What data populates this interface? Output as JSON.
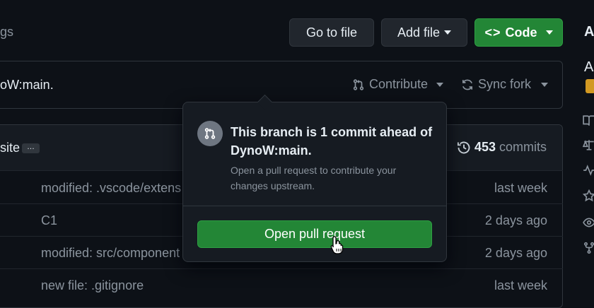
{
  "header": {
    "left_partial": "gs",
    "go_to_file": "Go to file",
    "add_file": "Add file",
    "code": "Code",
    "sidebar_title": "A"
  },
  "fork_bar": {
    "status_partial": "oW:main.",
    "contribute": "Contribute",
    "sync_fork": "Sync fork",
    "sidebar_letter": "A"
  },
  "commit_header": {
    "partial": "site",
    "ellipsis": "…",
    "commit_count": "453",
    "commits_label": "commits"
  },
  "files": [
    {
      "message": "modified: .vscode/extens",
      "time": "last week"
    },
    {
      "message": "C1",
      "time": "2 days ago"
    },
    {
      "message": "modified: src/component",
      "time": "2 days ago"
    },
    {
      "message": "new file: .gitignore",
      "time": "last week"
    }
  ],
  "popover": {
    "title_line1": "This branch is 1 commit ahead of",
    "title_line2": "DynoW:main.",
    "desc_line1": "Open a pull request to contribute your",
    "desc_line2": "changes upstream.",
    "button": "Open pull request"
  },
  "colors": {
    "green": "#238636",
    "background": "#0d1117",
    "popover_bg": "#161b22",
    "border": "#30363d"
  }
}
